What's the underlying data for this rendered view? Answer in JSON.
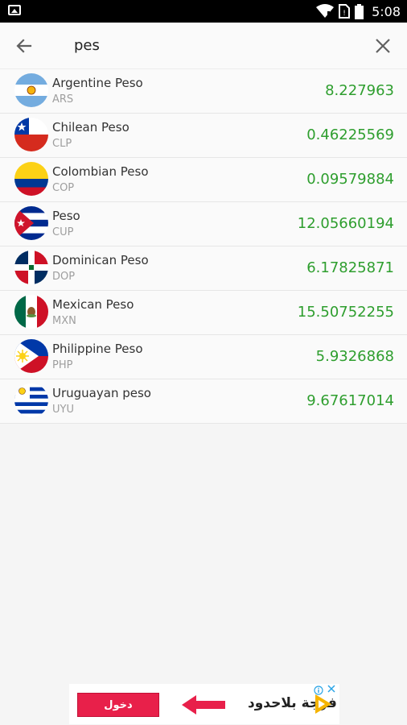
{
  "status_bar": {
    "time": "5:08",
    "icons": [
      "photo-icon",
      "wifi-icon",
      "no-sim-icon",
      "battery-icon"
    ]
  },
  "search": {
    "value": "pes",
    "back_icon": "arrow-left-icon",
    "clear_icon": "close-icon"
  },
  "currencies": [
    {
      "name": "Argentine Peso",
      "code": "ARS",
      "rate": "8.227963",
      "flag": "argentina-flag-icon"
    },
    {
      "name": "Chilean Peso",
      "code": "CLP",
      "rate": "0.46225569",
      "flag": "chile-flag-icon"
    },
    {
      "name": "Colombian Peso",
      "code": "COP",
      "rate": "0.09579884",
      "flag": "colombia-flag-icon"
    },
    {
      "name": "Peso",
      "code": "CUP",
      "rate": "12.05660194",
      "flag": "cuba-flag-icon"
    },
    {
      "name": "Dominican Peso",
      "code": "DOP",
      "rate": "6.17825871",
      "flag": "dominican-republic-flag-icon"
    },
    {
      "name": "Mexican Peso",
      "code": "MXN",
      "rate": "15.50752255",
      "flag": "mexico-flag-icon"
    },
    {
      "name": "Philippine Peso",
      "code": "PHP",
      "rate": "5.9326868",
      "flag": "philippines-flag-icon"
    },
    {
      "name": "Uruguayan peso",
      "code": "UYU",
      "rate": "9.67617014",
      "flag": "uruguay-flag-icon"
    }
  ],
  "ad": {
    "button_label": "دخول",
    "brand_text": "فرجة بلاحدود",
    "colors": {
      "button": "#e8204a",
      "arrow": "#e8204a",
      "play": "#f5b400"
    }
  },
  "colors": {
    "rate": "#2e9e2e",
    "code": "#9e9e9e",
    "name": "#333333"
  }
}
